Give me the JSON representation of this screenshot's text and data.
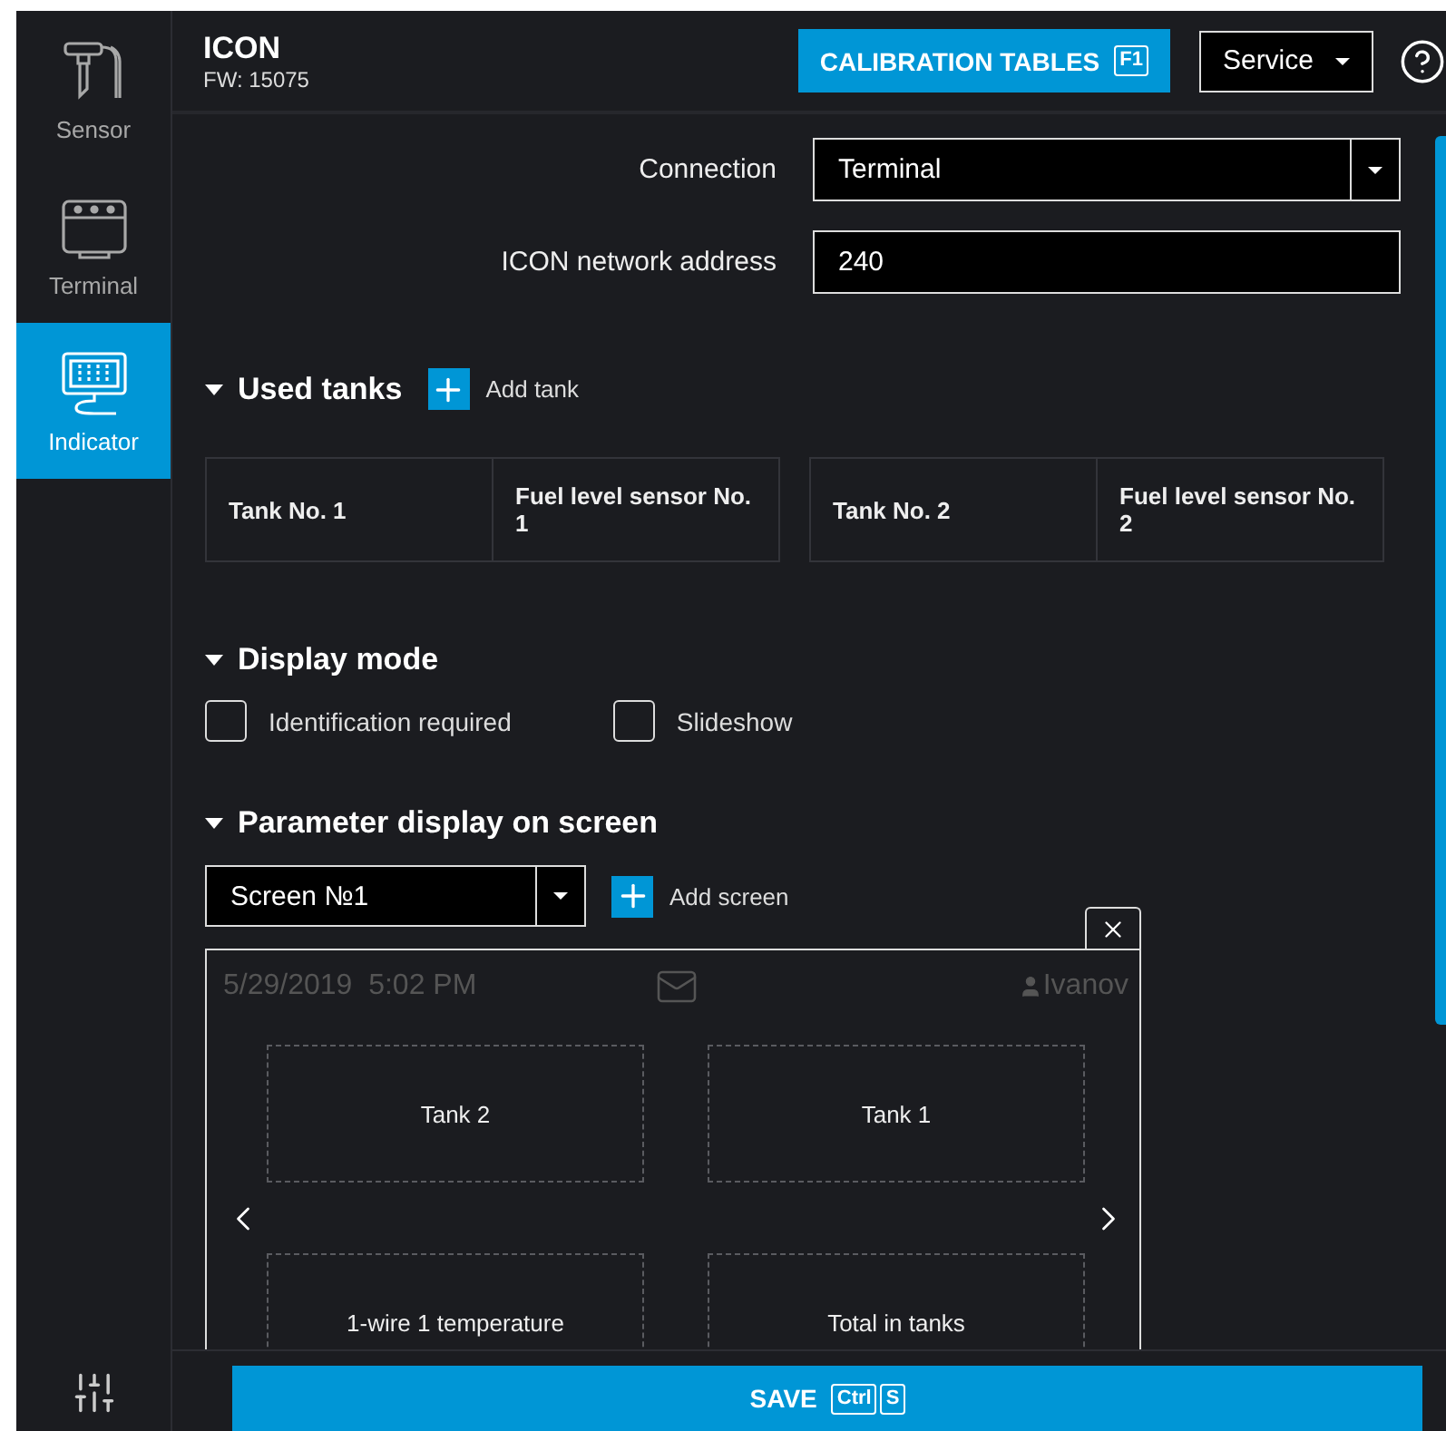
{
  "sidebar": {
    "items": [
      {
        "label": "Sensor",
        "kind": "sensor",
        "selected": false
      },
      {
        "label": "Terminal",
        "kind": "terminal",
        "selected": false
      },
      {
        "label": "Indicator",
        "kind": "indicator",
        "selected": true
      }
    ]
  },
  "header": {
    "title": "ICON",
    "firmware": "FW: 15075",
    "calibration_button": {
      "label": "CALIBRATION TABLES",
      "key": "F1"
    },
    "service_dropdown": "Service"
  },
  "form": [
    {
      "label": "Connection",
      "kind": "select",
      "value": "Terminal"
    },
    {
      "label": "ICON network address",
      "kind": "input",
      "value": "240"
    }
  ],
  "used_tanks": {
    "title": "Used tanks",
    "expanded": true,
    "add_button": "Add tank",
    "tanks": [
      {
        "cells": [
          "Tank No. 1",
          "Fuel level sensor No. 1"
        ]
      },
      {
        "cells": [
          "Tank No. 2",
          "Fuel level sensor No. 2"
        ]
      }
    ]
  },
  "display_mode": {
    "title": "Display mode",
    "expanded": true,
    "options": [
      {
        "label": "Identification required",
        "checked": false
      },
      {
        "label": "Slideshow",
        "checked": false
      }
    ]
  },
  "parameter_display": {
    "title": "Parameter display on screen",
    "expanded": true,
    "screen_select": "Screen №1",
    "add_button": "Add screen",
    "preview": {
      "date": "5/29/2019",
      "time": "5:02 PM",
      "user": "Ivanov",
      "tiles": [
        "Tank 2",
        "Tank 1",
        "1-wire 1 temperature",
        "Total in tanks"
      ]
    }
  },
  "save": {
    "label": "SAVE",
    "keys": [
      "Ctrl",
      "S"
    ]
  }
}
